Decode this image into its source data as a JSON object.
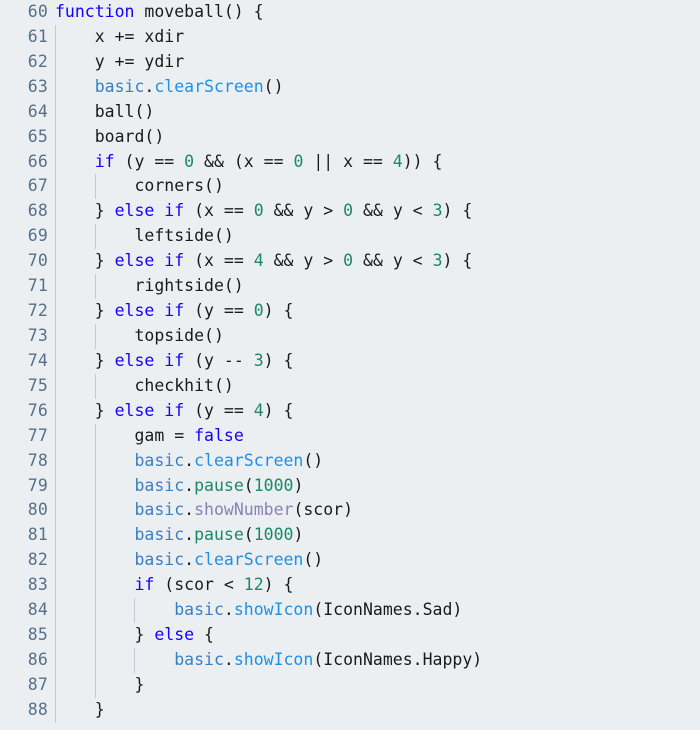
{
  "editor": {
    "background_color": "#eceff1",
    "gutter_text_color": "#55708a",
    "indent_guide_color": "#c3cbd1",
    "first_line_number": 60,
    "last_line_number": 88,
    "indent_unit_spaces": 4,
    "token_colors": {
      "keyword": "#1400ff",
      "namespace": "#3a7fc4",
      "method": "#1e90e8",
      "teal": "#1a8a63",
      "number": "#1a8a63",
      "mauve": "#8d7fb8",
      "plain": "#1a1a1a"
    }
  },
  "lines": [
    {
      "number": "60",
      "guides": 0,
      "tokens": [
        {
          "text": "function ",
          "cls": "t-kw"
        },
        {
          "text": "moveball() {",
          "cls": "t-plain"
        }
      ]
    },
    {
      "number": "61",
      "guides": 1,
      "tokens": [
        {
          "text": "    x += xdir",
          "cls": "t-plain"
        }
      ]
    },
    {
      "number": "62",
      "guides": 1,
      "tokens": [
        {
          "text": "    y += ydir",
          "cls": "t-plain"
        }
      ]
    },
    {
      "number": "63",
      "guides": 1,
      "tokens": [
        {
          "text": "    ",
          "cls": "t-plain"
        },
        {
          "text": "basic",
          "cls": "t-ns"
        },
        {
          "text": ".",
          "cls": "t-plain"
        },
        {
          "text": "clearScreen",
          "cls": "t-method"
        },
        {
          "text": "()",
          "cls": "t-plain"
        }
      ]
    },
    {
      "number": "64",
      "guides": 1,
      "tokens": [
        {
          "text": "    ball()",
          "cls": "t-plain"
        }
      ]
    },
    {
      "number": "65",
      "guides": 1,
      "tokens": [
        {
          "text": "    board()",
          "cls": "t-plain"
        }
      ]
    },
    {
      "number": "66",
      "guides": 1,
      "tokens": [
        {
          "text": "    ",
          "cls": "t-plain"
        },
        {
          "text": "if",
          "cls": "t-kw"
        },
        {
          "text": " (y == ",
          "cls": "t-plain"
        },
        {
          "text": "0",
          "cls": "t-num"
        },
        {
          "text": " && (x == ",
          "cls": "t-plain"
        },
        {
          "text": "0",
          "cls": "t-num"
        },
        {
          "text": " || x == ",
          "cls": "t-plain"
        },
        {
          "text": "4",
          "cls": "t-num"
        },
        {
          "text": ")) {",
          "cls": "t-plain"
        }
      ]
    },
    {
      "number": "67",
      "guides": 2,
      "tokens": [
        {
          "text": "        corners()",
          "cls": "t-plain"
        }
      ]
    },
    {
      "number": "68",
      "guides": 1,
      "tokens": [
        {
          "text": "    } ",
          "cls": "t-plain"
        },
        {
          "text": "else",
          "cls": "t-kw"
        },
        {
          "text": " ",
          "cls": "t-plain"
        },
        {
          "text": "if",
          "cls": "t-kw"
        },
        {
          "text": " (x == ",
          "cls": "t-plain"
        },
        {
          "text": "0",
          "cls": "t-num"
        },
        {
          "text": " && y > ",
          "cls": "t-plain"
        },
        {
          "text": "0",
          "cls": "t-num"
        },
        {
          "text": " && y < ",
          "cls": "t-plain"
        },
        {
          "text": "3",
          "cls": "t-num"
        },
        {
          "text": ") {",
          "cls": "t-plain"
        }
      ]
    },
    {
      "number": "69",
      "guides": 2,
      "tokens": [
        {
          "text": "        leftside()",
          "cls": "t-plain"
        }
      ]
    },
    {
      "number": "70",
      "guides": 1,
      "tokens": [
        {
          "text": "    } ",
          "cls": "t-plain"
        },
        {
          "text": "else",
          "cls": "t-kw"
        },
        {
          "text": " ",
          "cls": "t-plain"
        },
        {
          "text": "if",
          "cls": "t-kw"
        },
        {
          "text": " (x == ",
          "cls": "t-plain"
        },
        {
          "text": "4",
          "cls": "t-num"
        },
        {
          "text": " && y > ",
          "cls": "t-plain"
        },
        {
          "text": "0",
          "cls": "t-num"
        },
        {
          "text": " && y < ",
          "cls": "t-plain"
        },
        {
          "text": "3",
          "cls": "t-num"
        },
        {
          "text": ") {",
          "cls": "t-plain"
        }
      ]
    },
    {
      "number": "71",
      "guides": 2,
      "tokens": [
        {
          "text": "        rightside()",
          "cls": "t-plain"
        }
      ]
    },
    {
      "number": "72",
      "guides": 1,
      "tokens": [
        {
          "text": "    } ",
          "cls": "t-plain"
        },
        {
          "text": "else",
          "cls": "t-kw"
        },
        {
          "text": " ",
          "cls": "t-plain"
        },
        {
          "text": "if",
          "cls": "t-kw"
        },
        {
          "text": " (y == ",
          "cls": "t-plain"
        },
        {
          "text": "0",
          "cls": "t-num"
        },
        {
          "text": ") {",
          "cls": "t-plain"
        }
      ]
    },
    {
      "number": "73",
      "guides": 2,
      "tokens": [
        {
          "text": "        topside()",
          "cls": "t-plain"
        }
      ]
    },
    {
      "number": "74",
      "guides": 1,
      "tokens": [
        {
          "text": "    } ",
          "cls": "t-plain"
        },
        {
          "text": "else",
          "cls": "t-kw"
        },
        {
          "text": " ",
          "cls": "t-plain"
        },
        {
          "text": "if",
          "cls": "t-kw"
        },
        {
          "text": " (y -- ",
          "cls": "t-plain"
        },
        {
          "text": "3",
          "cls": "t-num"
        },
        {
          "text": ") {",
          "cls": "t-plain"
        }
      ]
    },
    {
      "number": "75",
      "guides": 2,
      "tokens": [
        {
          "text": "        checkhit()",
          "cls": "t-plain"
        }
      ]
    },
    {
      "number": "76",
      "guides": 1,
      "tokens": [
        {
          "text": "    } ",
          "cls": "t-plain"
        },
        {
          "text": "else",
          "cls": "t-kw"
        },
        {
          "text": " ",
          "cls": "t-plain"
        },
        {
          "text": "if",
          "cls": "t-kw"
        },
        {
          "text": " (y == ",
          "cls": "t-plain"
        },
        {
          "text": "4",
          "cls": "t-num"
        },
        {
          "text": ") {",
          "cls": "t-plain"
        }
      ]
    },
    {
      "number": "77",
      "guides": 2,
      "tokens": [
        {
          "text": "        gam = ",
          "cls": "t-plain"
        },
        {
          "text": "false",
          "cls": "t-kw"
        }
      ]
    },
    {
      "number": "78",
      "guides": 2,
      "tokens": [
        {
          "text": "        ",
          "cls": "t-plain"
        },
        {
          "text": "basic",
          "cls": "t-ns"
        },
        {
          "text": ".",
          "cls": "t-plain"
        },
        {
          "text": "clearScreen",
          "cls": "t-method"
        },
        {
          "text": "()",
          "cls": "t-plain"
        }
      ]
    },
    {
      "number": "79",
      "guides": 2,
      "tokens": [
        {
          "text": "        ",
          "cls": "t-plain"
        },
        {
          "text": "basic",
          "cls": "t-ns"
        },
        {
          "text": ".",
          "cls": "t-plain"
        },
        {
          "text": "pause",
          "cls": "t-teal"
        },
        {
          "text": "(",
          "cls": "t-plain"
        },
        {
          "text": "1000",
          "cls": "t-num"
        },
        {
          "text": ")",
          "cls": "t-plain"
        }
      ]
    },
    {
      "number": "80",
      "guides": 2,
      "tokens": [
        {
          "text": "        ",
          "cls": "t-plain"
        },
        {
          "text": "basic",
          "cls": "t-ns"
        },
        {
          "text": ".",
          "cls": "t-plain"
        },
        {
          "text": "showNumber",
          "cls": "t-mauve"
        },
        {
          "text": "(scor)",
          "cls": "t-plain"
        }
      ]
    },
    {
      "number": "81",
      "guides": 2,
      "tokens": [
        {
          "text": "        ",
          "cls": "t-plain"
        },
        {
          "text": "basic",
          "cls": "t-ns"
        },
        {
          "text": ".",
          "cls": "t-plain"
        },
        {
          "text": "pause",
          "cls": "t-teal"
        },
        {
          "text": "(",
          "cls": "t-plain"
        },
        {
          "text": "1000",
          "cls": "t-num"
        },
        {
          "text": ")",
          "cls": "t-plain"
        }
      ]
    },
    {
      "number": "82",
      "guides": 2,
      "tokens": [
        {
          "text": "        ",
          "cls": "t-plain"
        },
        {
          "text": "basic",
          "cls": "t-ns"
        },
        {
          "text": ".",
          "cls": "t-plain"
        },
        {
          "text": "clearScreen",
          "cls": "t-method"
        },
        {
          "text": "()",
          "cls": "t-plain"
        }
      ]
    },
    {
      "number": "83",
      "guides": 2,
      "tokens": [
        {
          "text": "        ",
          "cls": "t-plain"
        },
        {
          "text": "if",
          "cls": "t-kw"
        },
        {
          "text": " (scor < ",
          "cls": "t-plain"
        },
        {
          "text": "12",
          "cls": "t-num"
        },
        {
          "text": ") {",
          "cls": "t-plain"
        }
      ]
    },
    {
      "number": "84",
      "guides": 3,
      "tokens": [
        {
          "text": "            ",
          "cls": "t-plain"
        },
        {
          "text": "basic",
          "cls": "t-ns"
        },
        {
          "text": ".",
          "cls": "t-plain"
        },
        {
          "text": "showIcon",
          "cls": "t-method"
        },
        {
          "text": "(IconNames.Sad)",
          "cls": "t-plain"
        }
      ]
    },
    {
      "number": "85",
      "guides": 2,
      "tokens": [
        {
          "text": "        } ",
          "cls": "t-plain"
        },
        {
          "text": "else",
          "cls": "t-kw"
        },
        {
          "text": " {",
          "cls": "t-plain"
        }
      ]
    },
    {
      "number": "86",
      "guides": 3,
      "tokens": [
        {
          "text": "            ",
          "cls": "t-plain"
        },
        {
          "text": "basic",
          "cls": "t-ns"
        },
        {
          "text": ".",
          "cls": "t-plain"
        },
        {
          "text": "showIcon",
          "cls": "t-method"
        },
        {
          "text": "(IconNames.Happy)",
          "cls": "t-plain"
        }
      ]
    },
    {
      "number": "87",
      "guides": 2,
      "tokens": [
        {
          "text": "        }",
          "cls": "t-plain"
        }
      ]
    },
    {
      "number": "88",
      "guides": 1,
      "tokens": [
        {
          "text": "    }",
          "cls": "t-plain"
        }
      ]
    }
  ]
}
